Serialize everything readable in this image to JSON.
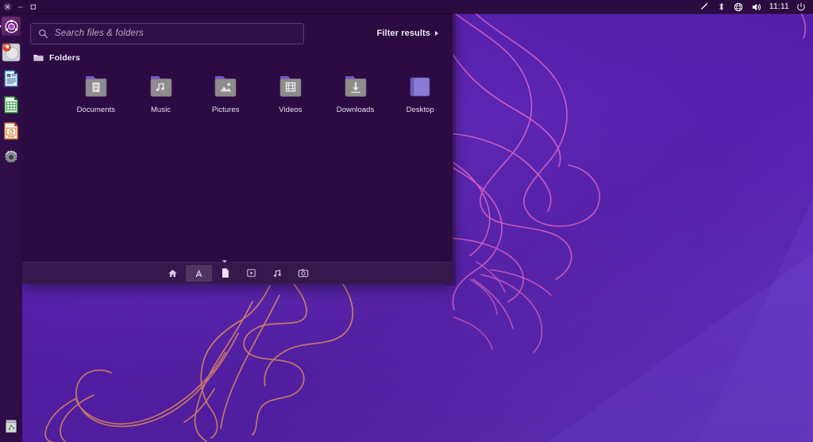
{
  "panel": {
    "window_controls": [
      {
        "name": "close-button",
        "glyph": "×"
      },
      {
        "name": "minimize-button",
        "glyph": "–"
      },
      {
        "name": "maximize-button",
        "glyph": "□"
      }
    ],
    "indicators": [
      {
        "name": "edit-indicator",
        "icon": "pencil-icon"
      },
      {
        "name": "bluetooth-indicator",
        "icon": "bluetooth-icon"
      },
      {
        "name": "network-indicator",
        "icon": "globe-network-icon"
      },
      {
        "name": "sound-indicator",
        "icon": "volume-speaker-icon"
      }
    ],
    "clock": "11:11",
    "session_icon": "power-icon"
  },
  "launcher": {
    "items": [
      {
        "name": "launcher-item-dash",
        "label": "Ubuntu Dash home",
        "icon": "ubuntu-bfb-icon",
        "active": true
      },
      {
        "name": "launcher-item-firefox",
        "label": "Firefox Web Browser",
        "icon": "firefox-icon",
        "active": false
      },
      {
        "name": "launcher-item-writer",
        "label": "LibreOffice Writer",
        "icon": "libreoffice-writer-icon",
        "active": false
      },
      {
        "name": "launcher-item-calc",
        "label": "LibreOffice Calc",
        "icon": "libreoffice-calc-icon",
        "active": false
      },
      {
        "name": "launcher-item-impress",
        "label": "LibreOffice Impress",
        "icon": "libreoffice-impress-icon",
        "active": false
      },
      {
        "name": "launcher-item-settings",
        "label": "System Settings",
        "icon": "gear-icon",
        "active": false
      }
    ],
    "trash": {
      "name": "launcher-item-trash",
      "label": "Trash",
      "icon": "trash-icon"
    }
  },
  "dash": {
    "search": {
      "placeholder": "Search files & folders",
      "value": "",
      "icon": "search-icon"
    },
    "filter": {
      "label": "Filter results",
      "icon": "triangle-right-icon"
    },
    "group": {
      "title": "Folders",
      "icon": "folder-icon"
    },
    "results": [
      {
        "name": "result-documents",
        "label": "Documents",
        "icon": "folder-documents-icon"
      },
      {
        "name": "result-music",
        "label": "Music",
        "icon": "folder-music-icon"
      },
      {
        "name": "result-pictures",
        "label": "Pictures",
        "icon": "folder-pictures-icon"
      },
      {
        "name": "result-videos",
        "label": "Videos",
        "icon": "folder-videos-icon"
      },
      {
        "name": "result-downloads",
        "label": "Downloads",
        "icon": "folder-downloads-icon"
      },
      {
        "name": "result-desktop",
        "label": "Desktop",
        "icon": "folder-desktop-icon"
      }
    ],
    "lenses": [
      {
        "name": "lens-home",
        "label": "Home",
        "icon": "home-icon",
        "selected": false
      },
      {
        "name": "lens-applications",
        "label": "Applications",
        "icon": "applications-a-icon",
        "selected": true
      },
      {
        "name": "lens-files",
        "label": "Files & Folders",
        "icon": "document-page-icon",
        "selected": false
      },
      {
        "name": "lens-video",
        "label": "Videos",
        "icon": "video-play-icon",
        "selected": false
      },
      {
        "name": "lens-music",
        "label": "Music",
        "icon": "music-note-icon",
        "selected": false
      },
      {
        "name": "lens-photos",
        "label": "Photos",
        "icon": "camera-icon",
        "selected": false
      }
    ]
  },
  "colors": {
    "dash_background": "#2b0a3e",
    "panel_background": "#2b0b3f",
    "desktop_purple": "#5b21b6",
    "wallpaper_line_pink": "#d45ec8",
    "wallpaper_line_salmon": "#e08a6a",
    "accent_white": "#ffffff"
  }
}
